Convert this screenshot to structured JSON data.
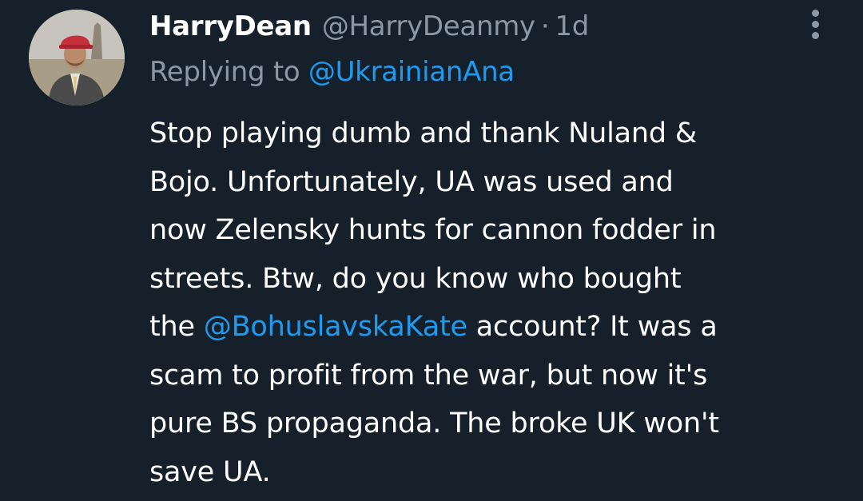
{
  "tweet": {
    "author": {
      "display_name": "HarryDean",
      "handle": "@HarryDeanmy",
      "avatar": "avatar-man-in-suit-red-cap"
    },
    "separator": "·",
    "timestamp": "1d",
    "more_icon": "more-vertical-icon",
    "replying": {
      "prefix": "Replying to ",
      "mention": "@UkrainianAna"
    },
    "body": {
      "line1": "Stop playing dumb and thank Nuland &",
      "line2": "Bojo. Unfortunately, UA was used and",
      "line3": "now Zelensky hunts for cannon fodder in",
      "line4": "streets. Btw, do you know who bought",
      "line5_before": "the ",
      "line5_mention": "@BohuslavskaKate",
      "line5_after": " account? It was a",
      "line6": "scam to profit from the war, but now it's",
      "line7": "pure BS propaganda. The broke UK won't",
      "line8": "save UA."
    }
  },
  "colors": {
    "background": "#15202b",
    "text_primary": "#ffffff",
    "text_secondary": "#8b98a5",
    "link": "#1d9bf0"
  }
}
